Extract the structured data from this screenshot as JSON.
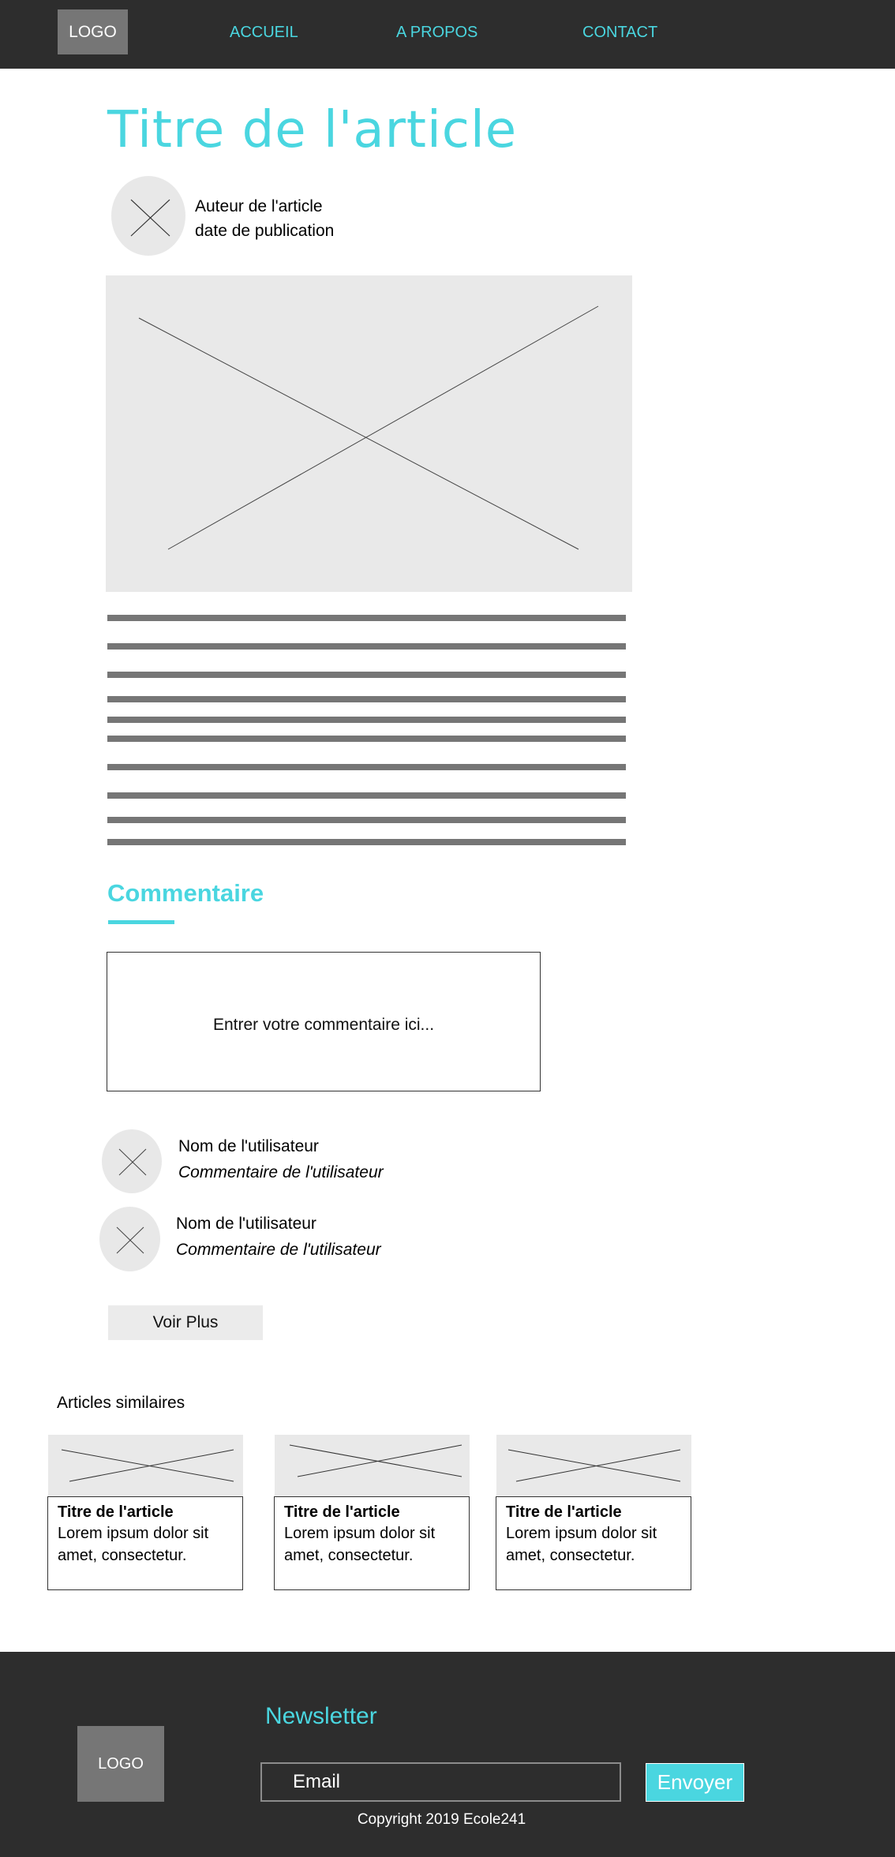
{
  "header": {
    "logo": "LOGO",
    "nav": [
      "ACCUEIL",
      "A PROPOS",
      "CONTACT"
    ]
  },
  "article": {
    "title": "Titre de l'article",
    "author": "Auteur de l'article",
    "date": "date de publication"
  },
  "comments": {
    "heading": "Commentaire",
    "placeholder": "Entrer votre commentaire ici...",
    "items": [
      {
        "user": "Nom de l'utilisateur",
        "text": "Commentaire de l'utilisateur"
      },
      {
        "user": "Nom de l'utilisateur",
        "text": "Commentaire de l'utilisateur"
      }
    ],
    "more": "Voir Plus"
  },
  "similar": {
    "heading": "Articles similaires",
    "cards": [
      {
        "title": "Titre de l'article",
        "text": "Lorem ipsum dolor sit amet, consectetur."
      },
      {
        "title": "Titre de l'article",
        "text": "Lorem ipsum dolor sit amet, consectetur."
      },
      {
        "title": "Titre de l'article",
        "text": "Lorem ipsum dolor sit amet, consectetur."
      }
    ]
  },
  "footer": {
    "logo": "LOGO",
    "newsletter": "Newsletter",
    "email_placeholder": "Email",
    "send": "Envoyer",
    "copyright": "Copyright 2019 Ecole241"
  },
  "colors": {
    "accent": "#4ad6e0",
    "dark": "#2d2d2d",
    "placeholder_gray": "#e9e9e9",
    "text_line_gray": "#767676"
  }
}
